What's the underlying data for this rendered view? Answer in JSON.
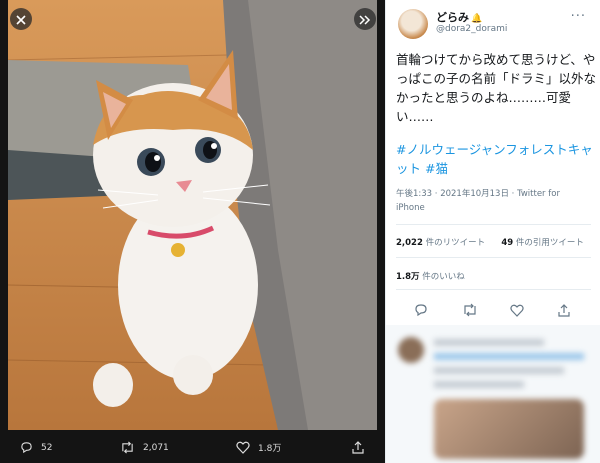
{
  "viewer": {
    "actions": {
      "reply_count": "52",
      "retweet_count": "2,071",
      "like_count": "1.8万"
    }
  },
  "tweet": {
    "name": "どらみ",
    "handle": "@dora2_dorami",
    "text": "首輪つけてから改めて思うけど、やっぱこの子の名前「ドラミ」以外なかったと思うのよね………可愛い……",
    "hashtags": "#ノルウェージャンフォレストキャット  #猫",
    "timestamp": "午後1:33 · 2021年10月13日 · Twitter for iPhone",
    "retweets_value": "2,022",
    "retweets_label": " 件のリツイート",
    "quotes_value": "49",
    "quotes_label": " 件の引用ツイート",
    "likes_value": "1.8万",
    "likes_label": " 件のいいね"
  },
  "colors": {
    "link": "#1b95e0",
    "text": "#14171a",
    "muted": "#657786"
  },
  "icons": [
    "close-icon",
    "expand-icon",
    "reply-icon",
    "retweet-icon",
    "like-icon",
    "share-icon",
    "more-icon"
  ]
}
